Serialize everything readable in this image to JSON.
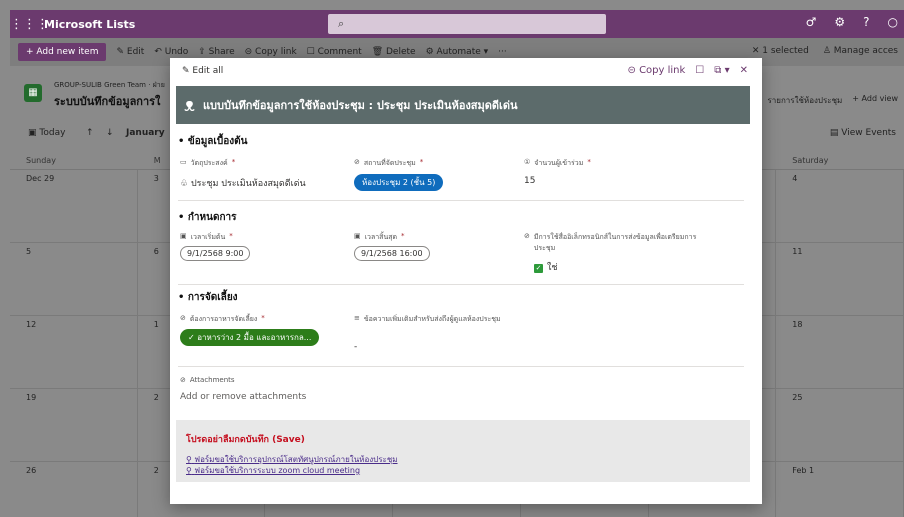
{
  "topbar": {
    "app_name": "Microsoft Lists",
    "search_placeholder": ""
  },
  "cmdbar": {
    "add_new": "+ Add new item",
    "edit": "Edit",
    "undo": "Undo",
    "share": "Share",
    "copy_link": "Copy link",
    "comment": "Comment",
    "delete": "Delete",
    "automate": "Automate",
    "more": "···",
    "selected": "1 selected",
    "manage": "Manage acces"
  },
  "list": {
    "group": "GROUP-SULIB Green Team · ฝ่าย",
    "title": "ระบบบันทึกข้อมูลการใ",
    "right_link": "รายการใช้ห้องประชุม",
    "add_view": "+ Add view",
    "view_events": "View Events"
  },
  "calendar": {
    "today": "Today",
    "month": "January",
    "days": [
      "Sunday",
      "M",
      "",
      "",
      "",
      "",
      "Saturday"
    ],
    "rows": [
      [
        "Dec 29",
        "3",
        "",
        "",
        "",
        "",
        "4"
      ],
      [
        "5",
        "6",
        "",
        "",
        "",
        "",
        "11"
      ],
      [
        "12",
        "1",
        "",
        "",
        "",
        "",
        "18"
      ],
      [
        "19",
        "2",
        "",
        "",
        "",
        "",
        "25"
      ],
      [
        "26",
        "2",
        "",
        "",
        "",
        "",
        "Feb 1"
      ]
    ]
  },
  "modal": {
    "edit_all": "Edit all",
    "copy_link": "Copy link",
    "title": "แบบบันทึกข้อมูลการใช้ห้องประชุม : ประชุม ประเมินห้องสมุดดีเด่น",
    "section1": "• ข้อมูลเบื้องต้น",
    "purpose_label": "วัตถุประสงค์",
    "purpose_value": "ประชุม ประเมินห้องสมุดดีเด่น",
    "place_label": "สถานที่จัดประชุม",
    "place_value": "ห้องประชุม 2 (ชั้น 5)",
    "attendees_label": "จำนวนผู้เข้าร่วม",
    "attendees_value": "15",
    "section2": "• กำหนดการ",
    "start_label": "เวลาเริ่มต้น",
    "start_value": "9/1/2568 9:00",
    "end_label": "เวลาสิ้นสุด",
    "end_value": "9/1/2568 16:00",
    "elec_label": "มีการใช้สื่ออิเล็กทรอนิกส์ในการส่งข้อมูลเพื่อเตรียมการประชุม",
    "elec_value": "ใช่",
    "section3": "• การจัดเลี้ยง",
    "catering_label": "ต้องการอาหารจัดเลี้ยง",
    "catering_value": "อาหารว่าง 2 มื้อ และอาหารกล...",
    "notes_label": "ข้อความเพิ่มเติมสำหรับส่งถึงผู้ดูแลห้องประชุม",
    "notes_value": "-",
    "attachments_label": "Attachments",
    "attachments_value": "Add or remove attachments",
    "save_warning": "โปรดอย่าลืมกดบันทึก (Save)",
    "link1": "ฟอร์มขอใช้บริการอุปกรณ์โสตทัศนูปกรณ์ภายในห้องประชุม",
    "link2": "ฟอร์มขอใช้บริการระบบ zoom cloud meeting"
  }
}
